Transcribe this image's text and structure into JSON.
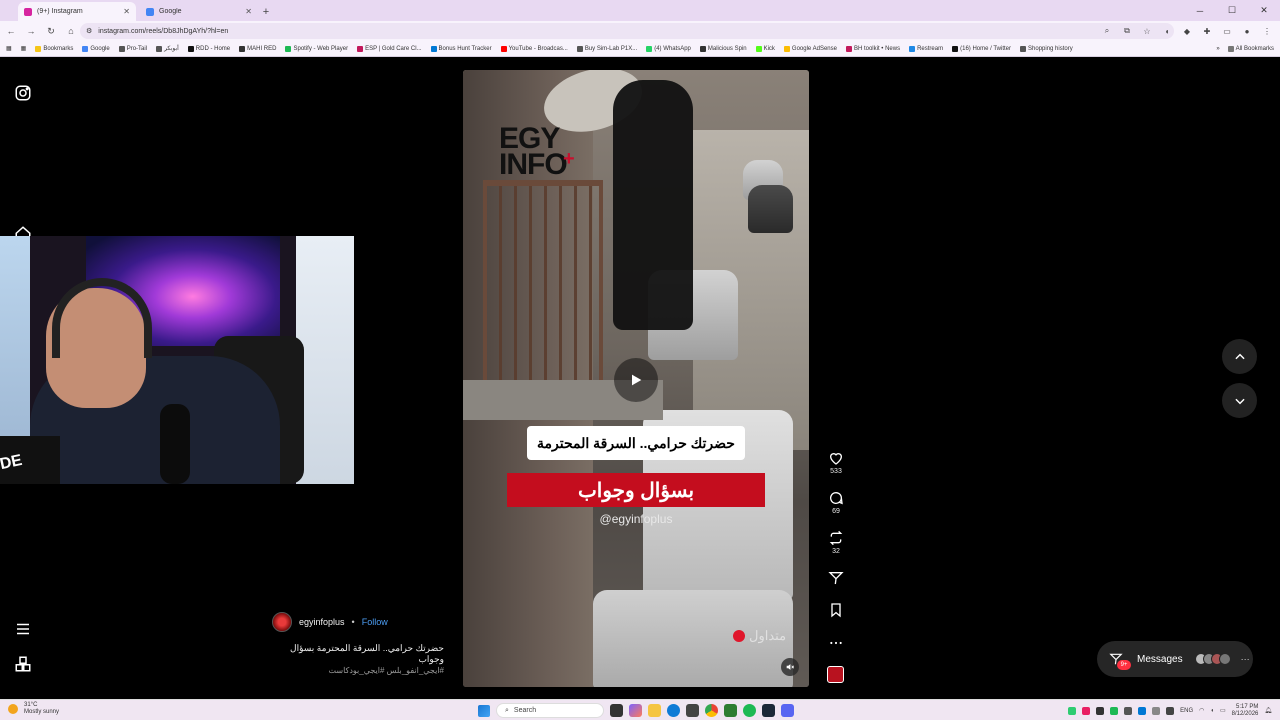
{
  "browser": {
    "tabs": [
      {
        "title": "(9+) Instagram",
        "active": true,
        "favicon_color": "#d6249f"
      },
      {
        "title": "Google",
        "active": false,
        "favicon_color": "#4285f4"
      }
    ],
    "new_tab_label": "+",
    "url": "instagram.com/reels/Db8JhDgAYh/?hl=en",
    "bookmarks": [
      {
        "label": "Bookmarks",
        "color": "#f5c518"
      },
      {
        "label": "Google",
        "color": "#4285f4"
      },
      {
        "label": "Pro-Tail",
        "color": "#555555"
      },
      {
        "label": "أبوبكر",
        "color": "#555555"
      },
      {
        "label": "RDD - Home",
        "color": "#111111"
      },
      {
        "label": "MAHI RED",
        "color": "#333333"
      },
      {
        "label": "Spotify - Web Player",
        "color": "#1db954"
      },
      {
        "label": "ESP | Gold Care Cl...",
        "color": "#c2185b"
      },
      {
        "label": "Bonus Hunt Tracker",
        "color": "#0078d4"
      },
      {
        "label": "YouTube - Broadcas...",
        "color": "#ff0000"
      },
      {
        "label": "Buy Sim-Lab P1X...",
        "color": "#555555"
      },
      {
        "label": "(4) WhatsApp",
        "color": "#25d366"
      },
      {
        "label": "Malicious Spin",
        "color": "#333333"
      },
      {
        "label": "Kick",
        "color": "#53fc18"
      },
      {
        "label": "Google AdSense",
        "color": "#fbbc04"
      },
      {
        "label": "BH toolkit • News",
        "color": "#c2185b"
      },
      {
        "label": "Restream",
        "color": "#1e88e5"
      },
      {
        "label": "(16) Home / Twitter",
        "color": "#111111"
      },
      {
        "label": "Shopping history",
        "color": "#555555"
      }
    ],
    "all_bookmarks_label": "All Bookmarks"
  },
  "reel": {
    "logo_line1": "EGY",
    "logo_line2": "INFO",
    "logo_plus": "+",
    "caption_white": "حضرتك حرامي.. السرقة المحترمة",
    "caption_red": "بسؤال وجواب",
    "handle": "@egyinfoplus",
    "watermark": "متداول"
  },
  "actions": {
    "likes": "533",
    "comments": "69",
    "reposts": "32"
  },
  "post": {
    "author": "egyinfoplus",
    "separator": "•",
    "follow_label": "Follow",
    "caption": "حضرتك حرامي.. السرقة المحترمة بسؤال وجواب",
    "hashtags": "#ايجي_انفو_بلس #ايجي_بودكاست"
  },
  "messages": {
    "label": "Messages",
    "badge": "9+",
    "more": "···"
  },
  "webcam": {
    "desk_text": "DE"
  },
  "taskbar": {
    "weather_temp": "31°C",
    "weather_desc": "Mostly sunny",
    "search_placeholder": "Search",
    "lang": "ENG",
    "time": "5:17 PM",
    "date": "8/12/2026"
  }
}
